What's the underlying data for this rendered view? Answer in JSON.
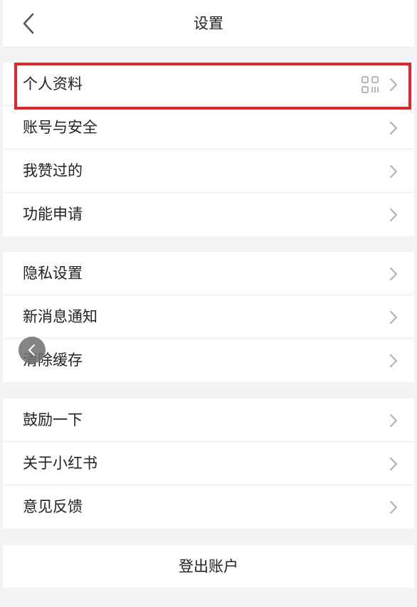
{
  "header": {
    "title": "设置"
  },
  "sections": [
    {
      "items": [
        {
          "label": "个人资料",
          "has_qr": true
        },
        {
          "label": "账号与安全"
        },
        {
          "label": "我赞过的"
        },
        {
          "label": "功能申请"
        }
      ]
    },
    {
      "items": [
        {
          "label": "隐私设置"
        },
        {
          "label": "新消息通知"
        },
        {
          "label": "清除缓存"
        }
      ]
    },
    {
      "items": [
        {
          "label": "鼓励一下"
        },
        {
          "label": "关于小红书"
        },
        {
          "label": "意见反馈"
        }
      ]
    }
  ],
  "logout": {
    "label": "登出账户"
  },
  "colors": {
    "highlight": "#e0262d",
    "background": "#f1f3f5",
    "text": "#222222",
    "chevron": "#b0b0b0"
  },
  "icons": {
    "back": "chevron-left-icon",
    "row_arrow": "chevron-right-icon",
    "qr": "qr-code-icon",
    "floating_back": "chevron-left-icon"
  }
}
